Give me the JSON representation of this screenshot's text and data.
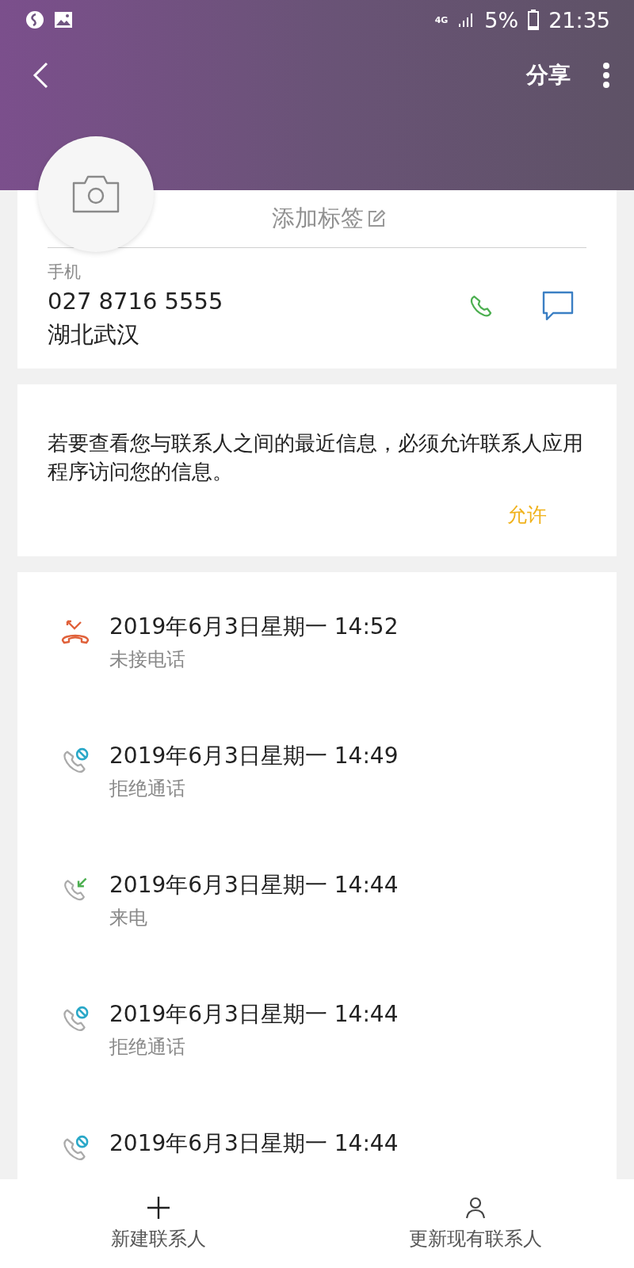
{
  "status_bar": {
    "network": "4G",
    "battery": "5%",
    "time": "21:35"
  },
  "toolbar": {
    "share": "分享"
  },
  "contact": {
    "add_tag": "添加标签",
    "phone_label": "手机",
    "phone": "027 8716 5555",
    "location": "湖北武汉"
  },
  "permission": {
    "message": "若要查看您与联系人之间的最近信息，必须允许联系人应用程序访问您的信息。",
    "allow": "允许"
  },
  "calls": [
    {
      "kind": "missed",
      "time": "2019年6月3日星期一 14:52",
      "type": "未接电话"
    },
    {
      "kind": "rejected",
      "time": "2019年6月3日星期一 14:49",
      "type": "拒绝通话"
    },
    {
      "kind": "incoming",
      "time": "2019年6月3日星期一 14:44",
      "type": "来电"
    },
    {
      "kind": "rejected",
      "time": "2019年6月3日星期一 14:44",
      "type": "拒绝通话"
    },
    {
      "kind": "rejected",
      "time": "2019年6月3日星期一 14:44"
    }
  ],
  "bottom_bar": [
    {
      "kind": "new",
      "label": "新建联系人"
    },
    {
      "kind": "update",
      "label": "更新现有联系人"
    }
  ]
}
